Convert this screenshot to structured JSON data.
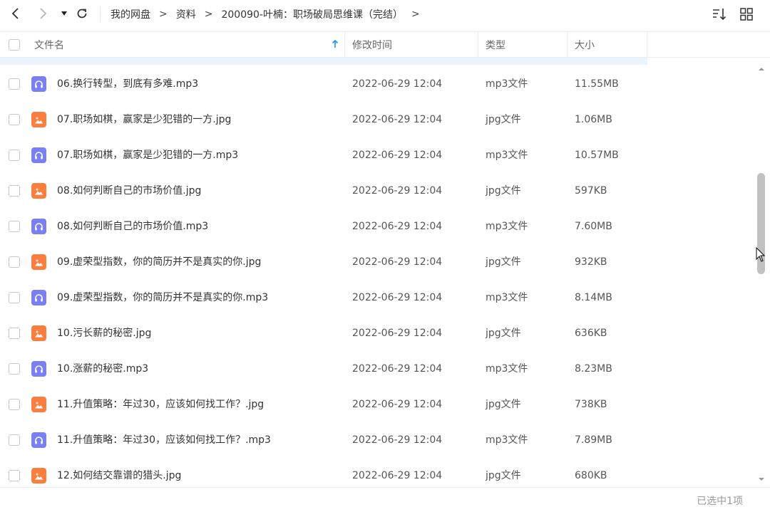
{
  "toolbar": {
    "breadcrumb": [
      "我的网盘",
      "资料",
      "200090-叶楠：职场破局思维课（完结）"
    ],
    "separator": ">"
  },
  "header": {
    "name_label": "文件名",
    "time_label": "修改时间",
    "type_label": "类型",
    "size_label": "大小",
    "sort": "ascending"
  },
  "files": [
    {
      "name": "06.换行转型，到底有多难.mp3",
      "time": "2022-06-29 12:04",
      "type": "mp3文件",
      "size": "11.55MB",
      "icon": "audio-file-icon"
    },
    {
      "name": "07.职场如棋，赢家是少犯错的一方.jpg",
      "time": "2022-06-29 12:04",
      "type": "jpg文件",
      "size": "1.06MB",
      "icon": "image-file-icon"
    },
    {
      "name": "07.职场如棋，赢家是少犯错的一方.mp3",
      "time": "2022-06-29 12:04",
      "type": "mp3文件",
      "size": "10.57MB",
      "icon": "audio-file-icon"
    },
    {
      "name": "08.如何判断自己的市场价值.jpg",
      "time": "2022-06-29 12:04",
      "type": "jpg文件",
      "size": "597KB",
      "icon": "image-file-icon"
    },
    {
      "name": "08.如何判断自己的市场价值.mp3",
      "time": "2022-06-29 12:04",
      "type": "mp3文件",
      "size": "7.60MB",
      "icon": "audio-file-icon"
    },
    {
      "name": "09.虚荣型指数，你的简历并不是真实的你.jpg",
      "time": "2022-06-29 12:04",
      "type": "jpg文件",
      "size": "932KB",
      "icon": "image-file-icon"
    },
    {
      "name": "09.虚荣型指数，你的简历并不是真实的你.mp3",
      "time": "2022-06-29 12:04",
      "type": "mp3文件",
      "size": "8.14MB",
      "icon": "audio-file-icon"
    },
    {
      "name": "10.污长薪的秘密.jpg",
      "time": "2022-06-29 12:04",
      "type": "jpg文件",
      "size": "636KB",
      "icon": "image-file-icon"
    },
    {
      "name": "10.涨薪的秘密.mp3",
      "time": "2022-06-29 12:04",
      "type": "mp3文件",
      "size": "8.23MB",
      "icon": "audio-file-icon"
    },
    {
      "name": "11.升值策略：年过30，应该如何找工作？.jpg",
      "time": "2022-06-29 12:04",
      "type": "jpg文件",
      "size": "738KB",
      "icon": "image-file-icon"
    },
    {
      "name": "11.升值策略：年过30，应该如何找工作？.mp3",
      "time": "2022-06-29 12:04",
      "type": "mp3文件",
      "size": "7.89MB",
      "icon": "audio-file-icon"
    },
    {
      "name": "12.如何结交靠谱的猎头.jpg",
      "time": "2022-06-29 12:04",
      "type": "jpg文件",
      "size": "680KB",
      "icon": "image-file-icon"
    }
  ],
  "footer": {
    "status": "已选中1项"
  },
  "colors": {
    "audio_icon": "#7b7ff6",
    "image_icon": "#fb7e3e",
    "sort_arrow": "#1e90ff"
  },
  "icons": [
    "back-arrow-icon",
    "forward-arrow-icon",
    "dropdown-icon",
    "refresh-icon",
    "sort-icon",
    "grid-view-icon",
    "scroll-up-icon",
    "scroll-down-icon"
  ]
}
